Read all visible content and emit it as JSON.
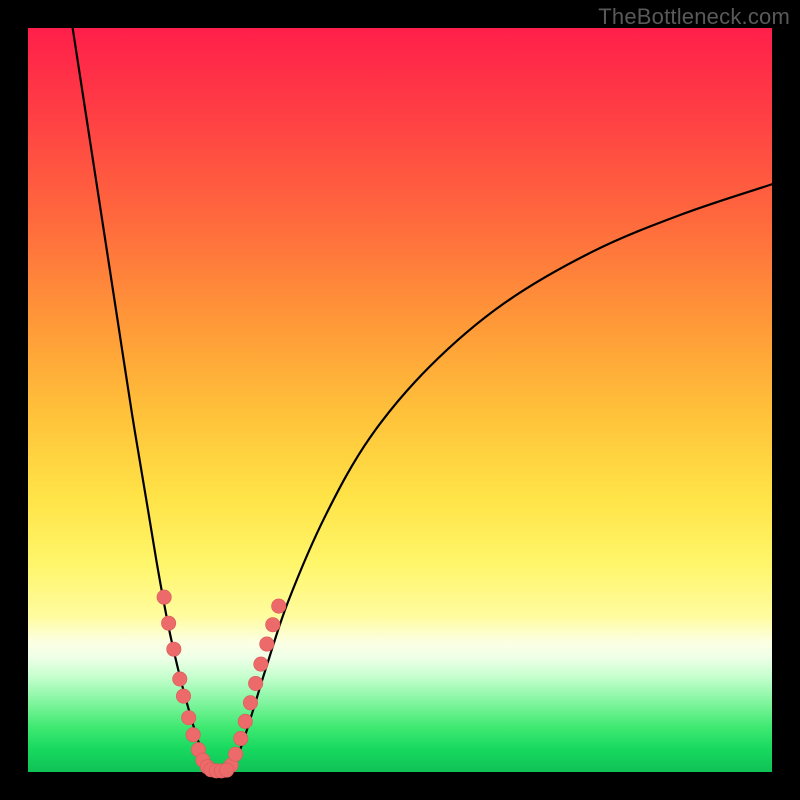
{
  "watermark": "TheBottleneck.com",
  "colors": {
    "marker_fill": "#ec6a6a",
    "marker_stroke": "#d95a5a",
    "curve": "#000000",
    "gradient_top": "#ff1f4a",
    "gradient_bottom": "#0fc256"
  },
  "chart_data": {
    "type": "line",
    "title": "",
    "xlabel": "",
    "ylabel": "",
    "xlim": [
      0,
      100
    ],
    "ylim": [
      0,
      100
    ],
    "grid": false,
    "legend": false,
    "note": "Axes unlabeled in source image; x and y are in percent of plot area. Gradient encodes severity (red=high bottleneck, green=none). Curves and markers were read off pixel positions.",
    "series": [
      {
        "name": "left-curve",
        "x": [
          6.0,
          8.0,
          10.0,
          12.0,
          14.0,
          16.0,
          17.5,
          19.0,
          20.5,
          22.0,
          23.0,
          23.8,
          24.6
        ],
        "y": [
          100.0,
          87.0,
          74.0,
          61.0,
          48.0,
          36.0,
          27.0,
          19.0,
          12.5,
          7.0,
          3.8,
          1.6,
          0.4
        ]
      },
      {
        "name": "right-curve",
        "x": [
          27.0,
          28.5,
          30.0,
          32.0,
          35.0,
          40.0,
          46.0,
          54.0,
          64.0,
          76.0,
          88.0,
          100.0
        ],
        "y": [
          0.4,
          3.0,
          7.5,
          14.0,
          23.0,
          34.5,
          45.0,
          54.5,
          63.0,
          70.0,
          75.0,
          79.0
        ]
      },
      {
        "name": "markers-left",
        "style": "scatter",
        "x": [
          18.3,
          18.9,
          19.6,
          20.4,
          20.9,
          21.6,
          22.2,
          22.9,
          23.5,
          24.1
        ],
        "y": [
          23.5,
          20.0,
          16.5,
          12.5,
          10.2,
          7.3,
          5.0,
          3.0,
          1.6,
          0.7
        ]
      },
      {
        "name": "markers-right",
        "style": "scatter",
        "x": [
          27.3,
          27.9,
          28.6,
          29.2,
          29.9,
          30.6,
          31.3,
          32.1,
          32.9,
          33.7
        ],
        "y": [
          0.9,
          2.4,
          4.5,
          6.8,
          9.3,
          11.9,
          14.5,
          17.2,
          19.8,
          22.3
        ]
      },
      {
        "name": "markers-bottom",
        "style": "scatter",
        "x": [
          24.6,
          25.3,
          26.0,
          26.7
        ],
        "y": [
          0.3,
          0.15,
          0.15,
          0.25
        ]
      }
    ]
  }
}
